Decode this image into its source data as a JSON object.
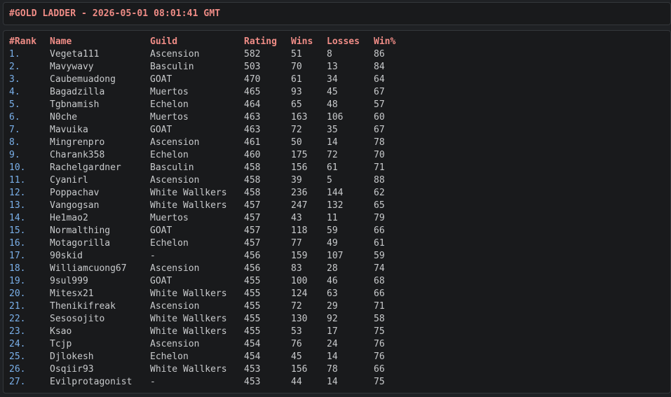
{
  "title": "#GOLD LADDER - 2026-05-01 08:01:41 GMT",
  "columns": [
    "#Rank",
    "Name",
    "Guild",
    "Rating",
    "Wins",
    "Losses",
    "Win%"
  ],
  "rows": [
    [
      "1.",
      "Vegeta111",
      "Ascension",
      "582",
      "51",
      "8",
      "86"
    ],
    [
      "2.",
      "Mavywavy",
      "Basculin",
      "503",
      "70",
      "13",
      "84"
    ],
    [
      "3.",
      "Caubemuadong",
      "GOAT",
      "470",
      "61",
      "34",
      "64"
    ],
    [
      "4.",
      "Bagadzilla",
      "Muertos",
      "465",
      "93",
      "45",
      "67"
    ],
    [
      "5.",
      "Tgbnamish",
      "Echelon",
      "464",
      "65",
      "48",
      "57"
    ],
    [
      "6.",
      "N0che",
      "Muertos",
      "463",
      "163",
      "106",
      "60"
    ],
    [
      "7.",
      "Mavuika",
      "GOAT",
      "463",
      "72",
      "35",
      "67"
    ],
    [
      "8.",
      "Mingrenpro",
      "Ascension",
      "461",
      "50",
      "14",
      "78"
    ],
    [
      "9.",
      "Charank358",
      "Echelon",
      "460",
      "175",
      "72",
      "70"
    ],
    [
      "10.",
      "Rachelgardner",
      "Basculin",
      "458",
      "156",
      "61",
      "71"
    ],
    [
      "11.",
      "Cyanirl",
      "Ascension",
      "458",
      "39",
      "5",
      "88"
    ],
    [
      "12.",
      "Poppachav",
      "White Wallkers",
      "458",
      "236",
      "144",
      "62"
    ],
    [
      "13.",
      "Vangogsan",
      "White Wallkers",
      "457",
      "247",
      "132",
      "65"
    ],
    [
      "14.",
      "He1mao2",
      "Muertos",
      "457",
      "43",
      "11",
      "79"
    ],
    [
      "15.",
      "Normalthing",
      "GOAT",
      "457",
      "118",
      "59",
      "66"
    ],
    [
      "16.",
      "Motagorilla",
      "Echelon",
      "457",
      "77",
      "49",
      "61"
    ],
    [
      "17.",
      "90skid",
      "-",
      "456",
      "159",
      "107",
      "59"
    ],
    [
      "18.",
      "Williamcuong67",
      "Ascension",
      "456",
      "83",
      "28",
      "74"
    ],
    [
      "19.",
      "9sul999",
      "GOAT",
      "455",
      "100",
      "46",
      "68"
    ],
    [
      "20.",
      "Mitesx21",
      "White Wallkers",
      "455",
      "124",
      "63",
      "66"
    ],
    [
      "21.",
      "Thenikifreak",
      "Ascension",
      "455",
      "72",
      "29",
      "71"
    ],
    [
      "22.",
      "Sesosojito",
      "White Wallkers",
      "455",
      "130",
      "92",
      "58"
    ],
    [
      "23.",
      "Ksao",
      "White Wallkers",
      "455",
      "53",
      "17",
      "75"
    ],
    [
      "24.",
      "Tcjp",
      "Ascension",
      "454",
      "76",
      "24",
      "76"
    ],
    [
      "25.",
      "Djlokesh",
      "Echelon",
      "454",
      "45",
      "14",
      "76"
    ],
    [
      "26.",
      "Osqiir93",
      "White Wallkers",
      "453",
      "156",
      "78",
      "66"
    ],
    [
      "27.",
      "Evilprotagonist",
      "-",
      "453",
      "44",
      "14",
      "75"
    ]
  ],
  "colors": {
    "background": "#1f2124",
    "panel": "#191a1c",
    "header_text": "#ef8c86",
    "rank_text": "#7ab0ea",
    "cell_text": "#c8cacc"
  }
}
